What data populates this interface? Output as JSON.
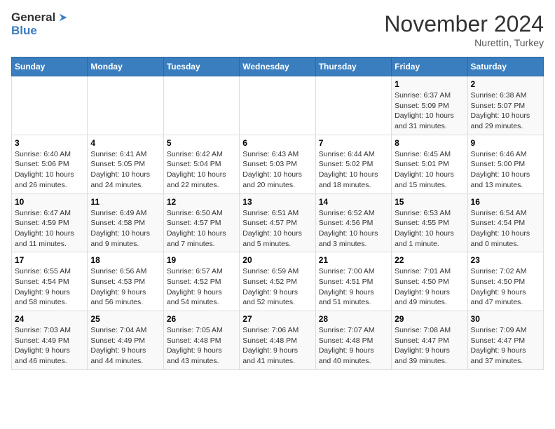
{
  "header": {
    "logo_general": "General",
    "logo_blue": "Blue",
    "month": "November 2024",
    "location": "Nurettin, Turkey"
  },
  "weekdays": [
    "Sunday",
    "Monday",
    "Tuesday",
    "Wednesday",
    "Thursday",
    "Friday",
    "Saturday"
  ],
  "weeks": [
    [
      {
        "day": "",
        "info": ""
      },
      {
        "day": "",
        "info": ""
      },
      {
        "day": "",
        "info": ""
      },
      {
        "day": "",
        "info": ""
      },
      {
        "day": "",
        "info": ""
      },
      {
        "day": "1",
        "info": "Sunrise: 6:37 AM\nSunset: 5:09 PM\nDaylight: 10 hours\nand 31 minutes."
      },
      {
        "day": "2",
        "info": "Sunrise: 6:38 AM\nSunset: 5:07 PM\nDaylight: 10 hours\nand 29 minutes."
      }
    ],
    [
      {
        "day": "3",
        "info": "Sunrise: 6:40 AM\nSunset: 5:06 PM\nDaylight: 10 hours\nand 26 minutes."
      },
      {
        "day": "4",
        "info": "Sunrise: 6:41 AM\nSunset: 5:05 PM\nDaylight: 10 hours\nand 24 minutes."
      },
      {
        "day": "5",
        "info": "Sunrise: 6:42 AM\nSunset: 5:04 PM\nDaylight: 10 hours\nand 22 minutes."
      },
      {
        "day": "6",
        "info": "Sunrise: 6:43 AM\nSunset: 5:03 PM\nDaylight: 10 hours\nand 20 minutes."
      },
      {
        "day": "7",
        "info": "Sunrise: 6:44 AM\nSunset: 5:02 PM\nDaylight: 10 hours\nand 18 minutes."
      },
      {
        "day": "8",
        "info": "Sunrise: 6:45 AM\nSunset: 5:01 PM\nDaylight: 10 hours\nand 15 minutes."
      },
      {
        "day": "9",
        "info": "Sunrise: 6:46 AM\nSunset: 5:00 PM\nDaylight: 10 hours\nand 13 minutes."
      }
    ],
    [
      {
        "day": "10",
        "info": "Sunrise: 6:47 AM\nSunset: 4:59 PM\nDaylight: 10 hours\nand 11 minutes."
      },
      {
        "day": "11",
        "info": "Sunrise: 6:49 AM\nSunset: 4:58 PM\nDaylight: 10 hours\nand 9 minutes."
      },
      {
        "day": "12",
        "info": "Sunrise: 6:50 AM\nSunset: 4:57 PM\nDaylight: 10 hours\nand 7 minutes."
      },
      {
        "day": "13",
        "info": "Sunrise: 6:51 AM\nSunset: 4:57 PM\nDaylight: 10 hours\nand 5 minutes."
      },
      {
        "day": "14",
        "info": "Sunrise: 6:52 AM\nSunset: 4:56 PM\nDaylight: 10 hours\nand 3 minutes."
      },
      {
        "day": "15",
        "info": "Sunrise: 6:53 AM\nSunset: 4:55 PM\nDaylight: 10 hours\nand 1 minute."
      },
      {
        "day": "16",
        "info": "Sunrise: 6:54 AM\nSunset: 4:54 PM\nDaylight: 10 hours\nand 0 minutes."
      }
    ],
    [
      {
        "day": "17",
        "info": "Sunrise: 6:55 AM\nSunset: 4:54 PM\nDaylight: 9 hours\nand 58 minutes."
      },
      {
        "day": "18",
        "info": "Sunrise: 6:56 AM\nSunset: 4:53 PM\nDaylight: 9 hours\nand 56 minutes."
      },
      {
        "day": "19",
        "info": "Sunrise: 6:57 AM\nSunset: 4:52 PM\nDaylight: 9 hours\nand 54 minutes."
      },
      {
        "day": "20",
        "info": "Sunrise: 6:59 AM\nSunset: 4:52 PM\nDaylight: 9 hours\nand 52 minutes."
      },
      {
        "day": "21",
        "info": "Sunrise: 7:00 AM\nSunset: 4:51 PM\nDaylight: 9 hours\nand 51 minutes."
      },
      {
        "day": "22",
        "info": "Sunrise: 7:01 AM\nSunset: 4:50 PM\nDaylight: 9 hours\nand 49 minutes."
      },
      {
        "day": "23",
        "info": "Sunrise: 7:02 AM\nSunset: 4:50 PM\nDaylight: 9 hours\nand 47 minutes."
      }
    ],
    [
      {
        "day": "24",
        "info": "Sunrise: 7:03 AM\nSunset: 4:49 PM\nDaylight: 9 hours\nand 46 minutes."
      },
      {
        "day": "25",
        "info": "Sunrise: 7:04 AM\nSunset: 4:49 PM\nDaylight: 9 hours\nand 44 minutes."
      },
      {
        "day": "26",
        "info": "Sunrise: 7:05 AM\nSunset: 4:48 PM\nDaylight: 9 hours\nand 43 minutes."
      },
      {
        "day": "27",
        "info": "Sunrise: 7:06 AM\nSunset: 4:48 PM\nDaylight: 9 hours\nand 41 minutes."
      },
      {
        "day": "28",
        "info": "Sunrise: 7:07 AM\nSunset: 4:48 PM\nDaylight: 9 hours\nand 40 minutes."
      },
      {
        "day": "29",
        "info": "Sunrise: 7:08 AM\nSunset: 4:47 PM\nDaylight: 9 hours\nand 39 minutes."
      },
      {
        "day": "30",
        "info": "Sunrise: 7:09 AM\nSunset: 4:47 PM\nDaylight: 9 hours\nand 37 minutes."
      }
    ]
  ]
}
